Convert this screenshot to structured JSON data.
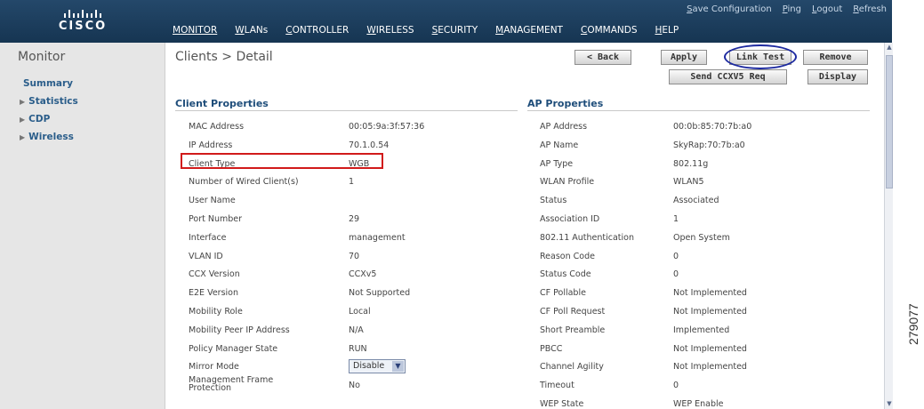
{
  "header": {
    "brand": "CISCO",
    "top_links": [
      "Save Configuration",
      "Ping",
      "Logout",
      "Refresh"
    ],
    "nav": [
      "MONITOR",
      "WLANs",
      "CONTROLLER",
      "WIRELESS",
      "SECURITY",
      "MANAGEMENT",
      "COMMANDS",
      "HELP"
    ],
    "active_nav": "MONITOR"
  },
  "sidebar": {
    "title": "Monitor",
    "summary": "Summary",
    "items": [
      "Statistics",
      "CDP",
      "Wireless"
    ]
  },
  "page": {
    "breadcrumb": "Clients > Detail",
    "buttons": {
      "back": "< Back",
      "apply": "Apply",
      "link_test": "Link Test",
      "remove": "Remove",
      "send_ccxv5": "Send CCXV5 Req",
      "display": "Display"
    }
  },
  "client_properties": {
    "heading": "Client Properties",
    "rows": [
      {
        "label": "MAC Address",
        "value": "00:05:9a:3f:57:36"
      },
      {
        "label": "IP Address",
        "value": "70.1.0.54"
      },
      {
        "label": "Client Type",
        "value": "WGB"
      },
      {
        "label": "Number of Wired Client(s)",
        "value": "1"
      },
      {
        "label": "User Name",
        "value": ""
      },
      {
        "label": "Port Number",
        "value": "29"
      },
      {
        "label": "Interface",
        "value": "management"
      },
      {
        "label": "VLAN ID",
        "value": "70"
      },
      {
        "label": "CCX Version",
        "value": "CCXv5"
      },
      {
        "label": "E2E Version",
        "value": "Not Supported"
      },
      {
        "label": "Mobility Role",
        "value": "Local"
      },
      {
        "label": "Mobility Peer IP Address",
        "value": "N/A"
      },
      {
        "label": "Policy Manager State",
        "value": "RUN"
      },
      {
        "label": "Mirror Mode",
        "value": "Disable"
      },
      {
        "label": "Management Frame Protection",
        "value": "No"
      }
    ]
  },
  "ap_properties": {
    "heading": "AP Properties",
    "rows": [
      {
        "label": "AP Address",
        "value": "00:0b:85:70:7b:a0"
      },
      {
        "label": "AP Name",
        "value": "SkyRap:70:7b:a0"
      },
      {
        "label": "AP Type",
        "value": "802.11g"
      },
      {
        "label": "WLAN Profile",
        "value": "WLAN5"
      },
      {
        "label": "Status",
        "value": "Associated"
      },
      {
        "label": "Association ID",
        "value": "1"
      },
      {
        "label": "802.11 Authentication",
        "value": "Open System"
      },
      {
        "label": "Reason Code",
        "value": "0"
      },
      {
        "label": "Status Code",
        "value": "0"
      },
      {
        "label": "CF Pollable",
        "value": "Not Implemented"
      },
      {
        "label": "CF Poll Request",
        "value": "Not Implemented"
      },
      {
        "label": "Short Preamble",
        "value": "Implemented"
      },
      {
        "label": "PBCC",
        "value": "Not Implemented"
      },
      {
        "label": "Channel Agility",
        "value": "Not Implemented"
      },
      {
        "label": "Timeout",
        "value": "0"
      },
      {
        "label": "WEP State",
        "value": "WEP Enable"
      }
    ]
  },
  "figure_number": "279077"
}
